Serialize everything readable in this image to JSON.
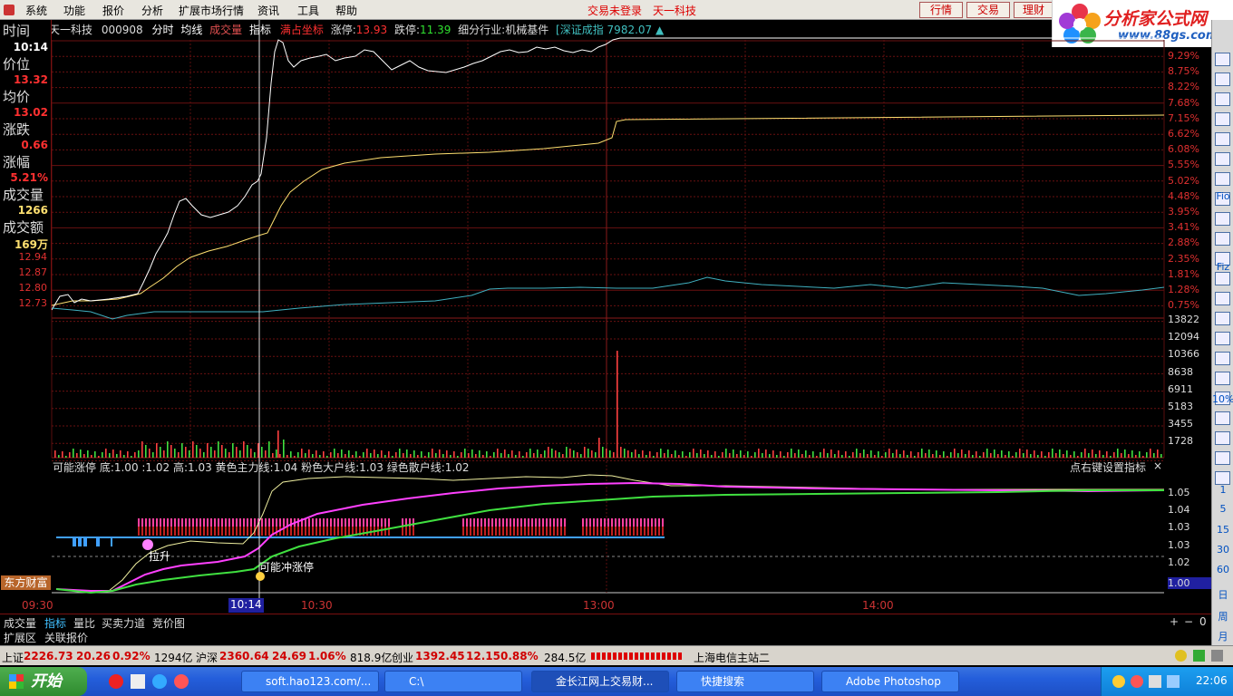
{
  "menu": [
    "系统",
    "功能",
    "报价",
    "分析",
    "扩展市场行情",
    "资讯",
    "工具",
    "帮助"
  ],
  "login_status": "交易未登录",
  "stock_title": "天一科技",
  "right_buttons": [
    "行情",
    "交易",
    "理财"
  ],
  "logo": {
    "name": "分析家公式网",
    "url": "www.88gs.com"
  },
  "info": {
    "name": "天一科技",
    "code": "000908",
    "tabs": [
      "分时",
      "均线",
      "成交量",
      "指标"
    ],
    "coord": "满占坐标",
    "limit_up_label": "涨停:",
    "limit_up": "13.93",
    "limit_down_label": "跌停:",
    "limit_down": "11.39",
    "industry": "细分行业:机械基件",
    "index": "[深证成指 7982.07 ▲"
  },
  "left_panel": {
    "time_label": "时间",
    "time": "10:14",
    "price_label": "价位",
    "price": "13.32",
    "avg_label": "均价",
    "avg": "13.02",
    "change_label": "涨跌",
    "change": "0.66",
    "pct_label": "涨幅",
    "pct": "5.21%",
    "vol_label": "成交量",
    "vol": "1266",
    "amt_label": "成交额",
    "amt": "169万",
    "prices": [
      "12.94",
      "12.87",
      "12.80",
      "12.73"
    ]
  },
  "right_pct_ticks": [
    "9.29%",
    "8.75%",
    "8.22%",
    "7.68%",
    "7.15%",
    "6.62%",
    "6.08%",
    "5.55%",
    "5.02%",
    "4.48%",
    "3.95%",
    "3.41%",
    "2.88%",
    "2.35%",
    "1.81%",
    "1.28%",
    "0.75%"
  ],
  "volume_ticks": [
    "13822",
    "12094",
    "10366",
    "8638",
    "6911",
    "5183",
    "3455",
    "1728"
  ],
  "indicator": {
    "header": "可能涨停 底:1.00 :1.02 高:1.03 黄色主力线:1.04 粉色大户线:1.03 绿色散户线:1.02",
    "hint": "点右键设置指标",
    "close": "×",
    "ticks": [
      "1.05",
      "1.04",
      "1.03",
      "1.03",
      "1.02",
      "1.00"
    ],
    "label_rise": "拉升",
    "label_limit": "可能冲涨停"
  },
  "broker_label": "东方财富",
  "time_axis": [
    "09:30",
    "10:14",
    "10:30",
    "13:00",
    "14:00"
  ],
  "bottom_tabs": [
    "成交量",
    "指标",
    "量比",
    "买卖力道",
    "竞价图"
  ],
  "bottom_tab_controls": [
    "+",
    "−",
    "0"
  ],
  "bottom_tabs2": [
    "扩展区",
    "关联报价"
  ],
  "status": {
    "sh_label": "上证",
    "sh_val": "2226.73",
    "sh_chg": "20.26",
    "sh_pct": "0.92%",
    "sh_amt": "1294亿",
    "sz_label": "沪深",
    "sz_val": "2360.64",
    "sz_chg": "24.69",
    "sz_pct": "1.06%",
    "sz_amt": "818.9亿",
    "cy_label": "创业",
    "cy_val": "1392.45",
    "cy_chg": "12.15",
    "cy_pct": "0.88%",
    "cy_amt": "284.5亿",
    "server": "上海电信主站二"
  },
  "sidebar_texts": [
    "Fio",
    "Fiz",
    "10%",
    "1",
    "5",
    "15",
    "30",
    "60",
    "日",
    "周",
    "月"
  ],
  "taskbar": {
    "start": "开始",
    "tasks": [
      "soft.hao123.com/...",
      "C:\\",
      "金长江网上交易财...",
      "快捷搜索",
      "Adobe Photoshop"
    ],
    "clock": "22:06"
  }
}
